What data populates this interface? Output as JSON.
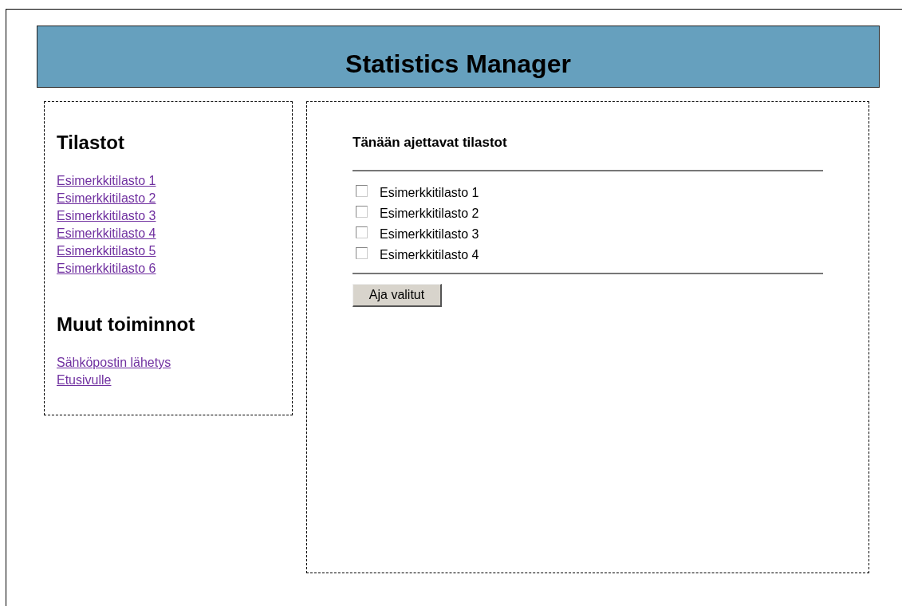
{
  "header": {
    "title": "Statistics Manager"
  },
  "sidebar": {
    "sections": [
      {
        "heading": "Tilastot",
        "links": [
          "Esimerkkitilasto 1",
          "Esimerkkitilasto 2",
          "Esimerkkitilasto 3",
          "Esimerkkitilasto 4",
          "Esimerkkitilasto 5",
          "Esimerkkitilasto 6"
        ]
      },
      {
        "heading": "Muut toiminnot",
        "links": [
          "Sähköpostin lähetys",
          "Etusivulle"
        ]
      }
    ]
  },
  "main": {
    "heading": "Tänään ajettavat tilastot",
    "statistics": [
      {
        "label": "Esimerkkitilasto 1",
        "checked": false
      },
      {
        "label": "Esimerkkitilasto 2",
        "checked": false
      },
      {
        "label": "Esimerkkitilasto 3",
        "checked": false
      },
      {
        "label": "Esimerkkitilasto 4",
        "checked": false
      }
    ],
    "button": "Aja valitut"
  }
}
